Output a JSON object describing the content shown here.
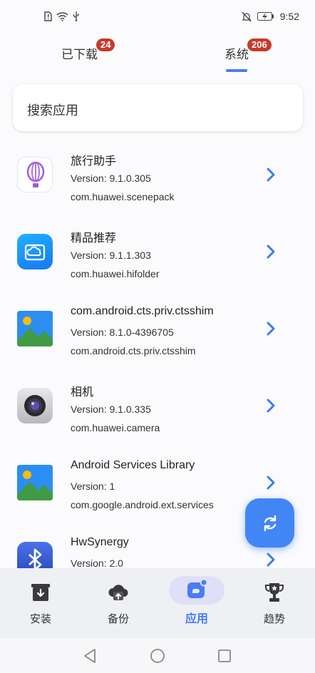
{
  "status_bar": {
    "left_icons": [
      "sim-alert-icon",
      "wifi-question-icon",
      "usb-icon"
    ],
    "right_icons": [
      "bell-off-icon",
      "battery-icon"
    ],
    "time": "9:52"
  },
  "tabs": [
    {
      "label": "已下载",
      "badge": "24"
    },
    {
      "label": "系统",
      "badge": "206",
      "active": true
    }
  ],
  "search": {
    "placeholder": "搜索应用"
  },
  "apps": [
    {
      "name": "旅行助手",
      "version": "Version: 9.1.0.305",
      "package": "com.huawei.scenepack",
      "icon": "balloon-icon"
    },
    {
      "name": "精品推荐",
      "version": "Version: 9.1.1.303",
      "package": "com.huawei.hifolder",
      "icon": "cloud-folder-icon"
    },
    {
      "name": "com.android.cts.priv.ctsshim",
      "version": "Version: 8.1.0-4396705",
      "package": "com.android.cts.priv.ctsshim",
      "icon": "landscape-icon"
    },
    {
      "name": "相机",
      "version": "Version: 9.1.0.335",
      "package": "com.huawei.camera",
      "icon": "camera-icon"
    },
    {
      "name": "Android Services Library",
      "version": "Version: 1",
      "package": "com.google.android.ext.services",
      "icon": "landscape-icon"
    },
    {
      "name": "HwSynergy",
      "version": "Version: 2.0",
      "package": "",
      "icon": "bluetooth-icon"
    }
  ],
  "fab": {
    "icon": "refresh-icon"
  },
  "bottom_nav": [
    {
      "label": "安装",
      "icon": "install-icon"
    },
    {
      "label": "备份",
      "icon": "cloud-backup-icon"
    },
    {
      "label": "应用",
      "icon": "apps-icon",
      "active": true
    },
    {
      "label": "趋势",
      "icon": "trophy-icon"
    }
  ],
  "colors": {
    "accent": "#4a7bf7",
    "badge": "#c73a2b",
    "fab": "#4285f4"
  }
}
